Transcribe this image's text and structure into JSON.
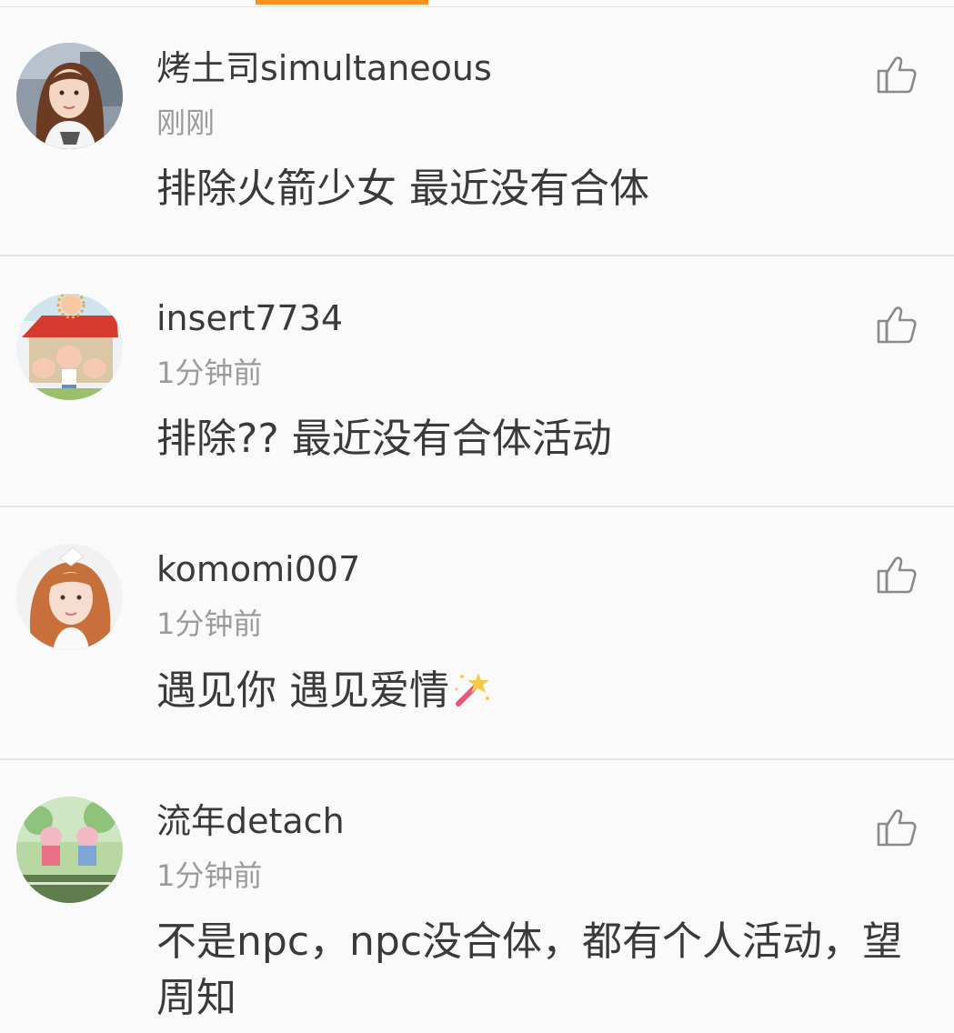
{
  "tab_indicator_color": "#f7931e",
  "comments": [
    {
      "username": "烤土司simultaneous",
      "time": "刚刚",
      "text": "排除火箭少女 最近没有合体",
      "avatar": "photo-girl-avatar",
      "like_icon": "thumbs-up-icon"
    },
    {
      "username": "insert7734",
      "time": "1分钟前",
      "text": "排除?? 最近没有合体活动",
      "avatar": "cartoon-pigs-house-avatar",
      "like_icon": "thumbs-up-icon"
    },
    {
      "username": "komomi007",
      "time": "1分钟前",
      "text": "遇见你 遇见爱情",
      "emoji": "magic-wand-emoji",
      "avatar": "photo-girl-red-hair-avatar",
      "like_icon": "thumbs-up-icon"
    },
    {
      "username": "流年detach",
      "time": "1分钟前",
      "text": "不是npc，npc没合体，都有个人活动，望周知",
      "avatar": "cartoon-pigs-garden-avatar",
      "like_icon": "thumbs-up-icon"
    }
  ]
}
